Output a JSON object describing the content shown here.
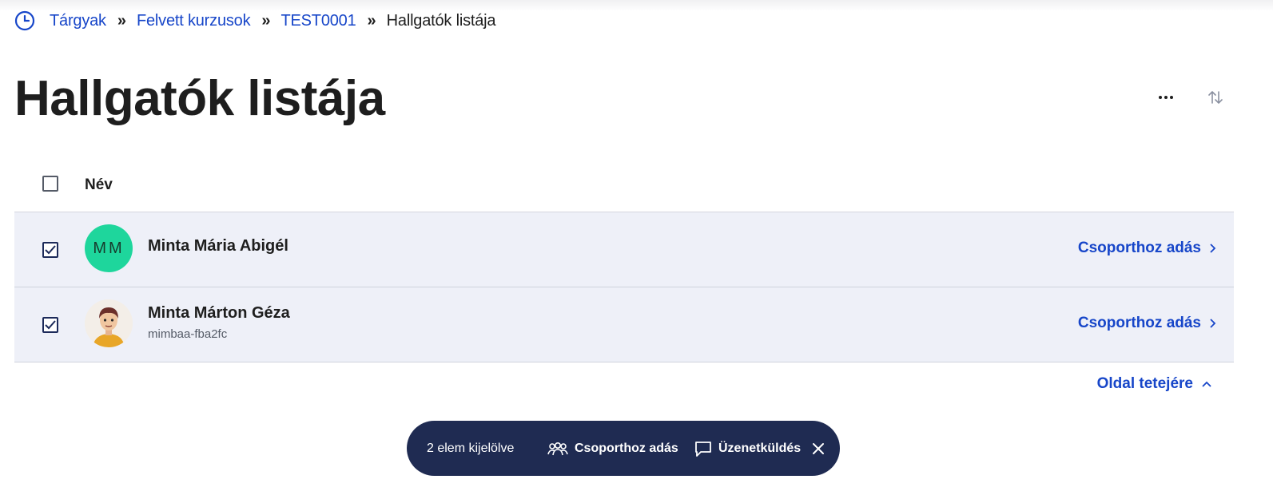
{
  "colors": {
    "link": "#1746c9",
    "row_selected_bg": "#eef0f8",
    "selection_bar_bg": "#1f2b52",
    "avatar_initials_bg": "#1ed69c"
  },
  "breadcrumb": {
    "home_icon": "clock-icon",
    "items": [
      "Tárgyak",
      "Felvett kurzusok",
      "TEST0001"
    ],
    "current": "Hallgatók listája",
    "separator": "»"
  },
  "page": {
    "title": "Hallgatók listája",
    "more_icon": "more-horizontal-icon",
    "sort_icon": "sort-arrows-icon"
  },
  "table": {
    "header_name": "Név",
    "select_all_checked": false,
    "rows": [
      {
        "checked": true,
        "avatar_initials": "MM",
        "name": "Minta Mária Abigél",
        "sub": "",
        "action": "Csoporthoz adás"
      },
      {
        "checked": true,
        "avatar_icon": "person-photo",
        "name": "Minta Márton Géza",
        "sub": "mimbaa-fba2fc",
        "action": "Csoporthoz adás"
      }
    ]
  },
  "back_to_top": "Oldal tetejére",
  "selection_bar": {
    "count_label": "2 elem kijelölve",
    "group_label": "Csoporthoz adás",
    "message_label": "Üzenetküldés",
    "close_icon": "close-icon"
  }
}
